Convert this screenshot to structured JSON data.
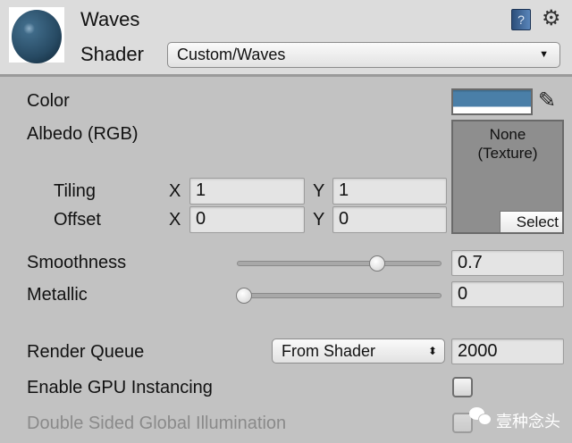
{
  "header": {
    "title": "Waves",
    "shader_label": "Shader",
    "shader_value": "Custom/Waves"
  },
  "properties": {
    "color": {
      "label": "Color",
      "value": "#4a7fa8"
    },
    "albedo": {
      "label": "Albedo (RGB)",
      "texture_line1": "None",
      "texture_line2": "(Texture)",
      "select_label": "Select"
    },
    "tiling": {
      "label": "Tiling",
      "x_label": "X",
      "x": "1",
      "y_label": "Y",
      "y": "1"
    },
    "offset": {
      "label": "Offset",
      "x_label": "X",
      "x": "0",
      "y_label": "Y",
      "y": "0"
    },
    "smoothness": {
      "label": "Smoothness",
      "value": "0.7",
      "fraction": 0.7
    },
    "metallic": {
      "label": "Metallic",
      "value": "0",
      "fraction": 0
    }
  },
  "render_queue": {
    "label": "Render Queue",
    "mode": "From Shader",
    "value": "2000"
  },
  "gpu_instancing": {
    "label": "Enable GPU Instancing",
    "checked": false
  },
  "double_sided_gi": {
    "label": "Double Sided Global Illumination",
    "checked": false
  },
  "watermark": {
    "text": "壹种念头"
  }
}
